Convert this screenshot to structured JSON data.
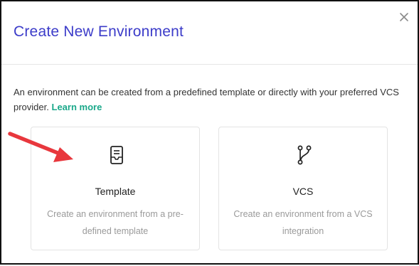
{
  "dialog": {
    "title": "Create New Environment",
    "close_icon": "close-icon",
    "description": "An environment can be created from a predefined template or directly with your preferred VCS provider.",
    "learn_more": "Learn more"
  },
  "options": [
    {
      "title": "Template",
      "description": "Create an environment from a pre-defined template",
      "icon": "template-icon"
    },
    {
      "title": "VCS",
      "description": "Create an environment from a VCS integration",
      "icon": "branch-icon"
    }
  ],
  "colors": {
    "title": "#3c3cc9",
    "link": "#1aa88a",
    "annotation_arrow": "#e8373d",
    "frame_border": "#111111"
  }
}
